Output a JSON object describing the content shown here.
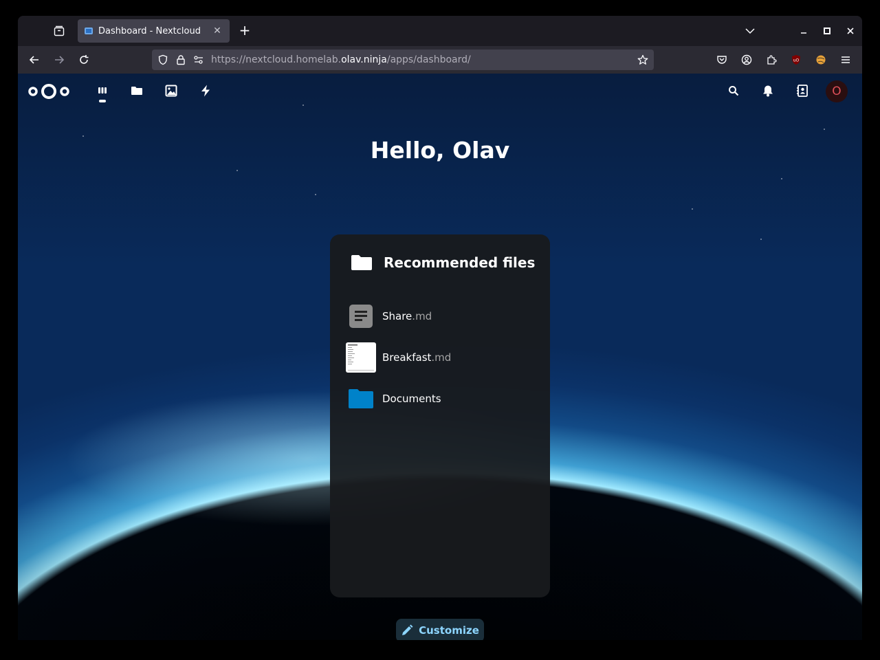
{
  "browser": {
    "tab_title": "Dashboard - Nextcloud",
    "url_prefix": "https://nextcloud.homelab.",
    "url_host": "olav.ninja",
    "url_path": "/apps/dashboard/"
  },
  "header": {
    "apps": [
      {
        "name": "dashboard-icon"
      },
      {
        "name": "folder-icon"
      },
      {
        "name": "image-icon"
      },
      {
        "name": "lightning-icon"
      }
    ],
    "right_icons": [
      "search-icon",
      "bell-icon",
      "contacts-icon"
    ],
    "avatar_letter": "O"
  },
  "greeting": "Hello, Olav",
  "panel": {
    "title": "Recommended files",
    "files": [
      {
        "name": "Share",
        "ext": ".md",
        "icon": "text-document-icon"
      },
      {
        "name": "Breakfast",
        "ext": ".md",
        "icon": "document-preview-icon"
      },
      {
        "name": "Documents",
        "ext": "",
        "icon": "folder-icon"
      }
    ]
  },
  "customize_label": "Customize",
  "colors": {
    "accent": "#8dd5ff",
    "folder": "#0082c9"
  }
}
